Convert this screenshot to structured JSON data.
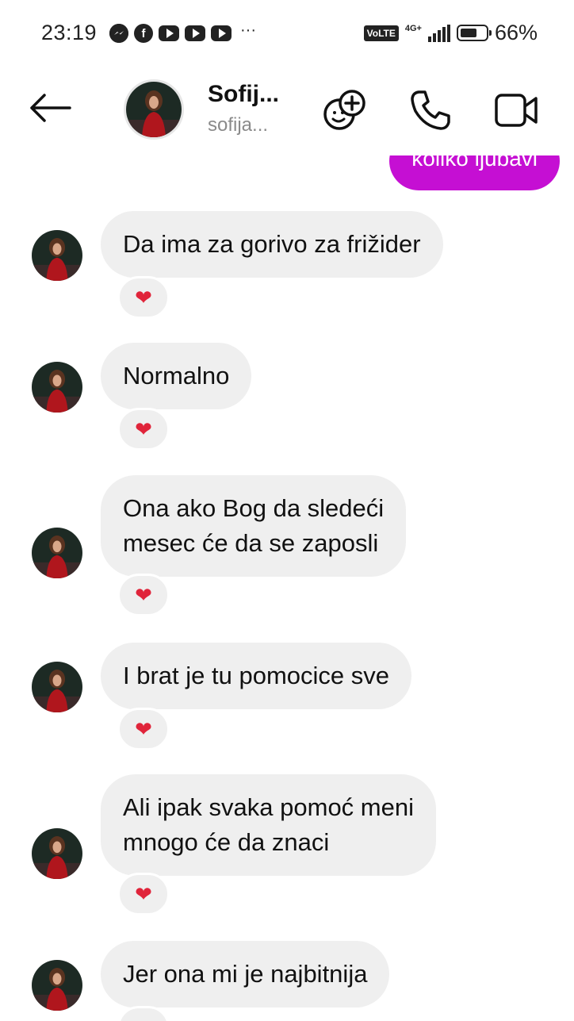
{
  "status_bar": {
    "time": "23:19",
    "app_icons": [
      "messenger-icon",
      "facebook-icon",
      "youtube-icon",
      "youtube-icon",
      "youtube-icon"
    ],
    "more": "···",
    "volte": "VoLTE",
    "network": "4G+",
    "battery": "66%",
    "battery_level": 0.66
  },
  "header": {
    "name": "Sofij...",
    "username": "sofija...",
    "actions": [
      "add-effect-icon",
      "phone-icon",
      "video-icon"
    ]
  },
  "chat": {
    "accent": "#c50fd3",
    "sent_partial": "koliko ljubavi",
    "messages": [
      {
        "line1": "Da ima za gorivo za frižider",
        "line2": "",
        "reaction": "❤"
      },
      {
        "line1": "Normalno",
        "line2": "",
        "reaction": "❤"
      },
      {
        "line1": "Ona ako Bog da sledeći",
        "line2": "mesec će da se zaposli",
        "reaction": "❤"
      },
      {
        "line1": "I brat je tu pomocice sve",
        "line2": "",
        "reaction": "❤"
      },
      {
        "line1": "Ali ipak svaka pomoć meni",
        "line2": "mnogo će da znaci",
        "reaction": "❤"
      },
      {
        "line1": "Jer ona mi je najbitnija",
        "line2": "",
        "reaction": "❤"
      }
    ]
  }
}
